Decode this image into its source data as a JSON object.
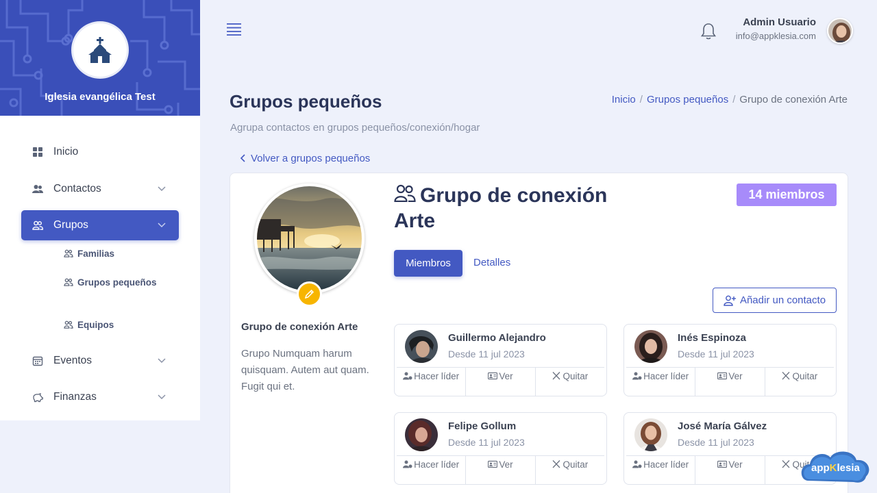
{
  "brand": {
    "name": "Iglesia evangélica Test"
  },
  "sidebar": {
    "items": [
      {
        "label": "Inicio"
      },
      {
        "label": "Contactos"
      },
      {
        "label": "Grupos"
      },
      {
        "label": "Eventos"
      },
      {
        "label": "Finanzas"
      }
    ],
    "subitems": [
      {
        "label": "Familias"
      },
      {
        "label": "Grupos pequeños"
      },
      {
        "label": "Equipos"
      }
    ]
  },
  "header": {
    "user_name": "Admin Usuario",
    "user_email": "info@appklesia.com"
  },
  "page": {
    "title": "Grupos pequeños",
    "subtitle": "Agrupa contactos en grupos pequeños/conexión/hogar",
    "breadcrumb": [
      "Inicio",
      "Grupos pequeños",
      "Grupo de conexión Arte"
    ],
    "back_label": "Volver a grupos pequeños"
  },
  "group": {
    "name": "Grupo de conexión Arte",
    "description": "Grupo Numquam harum quisquam. Autem aut quam. Fugit qui et.",
    "members_badge": "14 miembros",
    "tabs": [
      "Miembros",
      "Detalles"
    ],
    "add_contact_label": "Añadir un contacto"
  },
  "members": [
    {
      "name": "Guillermo Alejandro",
      "since": "Desde 11 jul 2023"
    },
    {
      "name": "Inés Espinoza",
      "since": "Desde 11 jul 2023"
    },
    {
      "name": "Felipe Gollum",
      "since": "Desde 11 jul 2023"
    },
    {
      "name": "José María Gálvez",
      "since": "Desde 11 jul 2023"
    }
  ],
  "member_actions": {
    "leader": "Hacer líder",
    "view": "Ver",
    "remove": "Quitar"
  },
  "app_logo": {
    "part1": "app",
    "part2": "K",
    "part3": "lesia"
  },
  "colors": {
    "primary": "#4359c2",
    "badge": "#a78bfa",
    "edit": "#f7b500",
    "background": "#eef1fb"
  }
}
